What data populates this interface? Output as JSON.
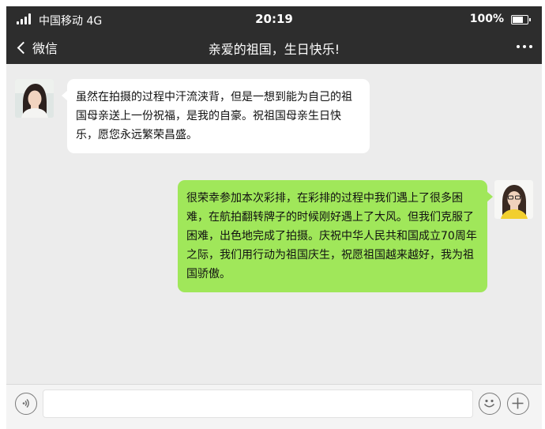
{
  "status_bar": {
    "carrier": "中国移动 4G",
    "time": "20:19",
    "battery": "100%",
    "battery_level": 1.0
  },
  "nav": {
    "back_label": "微信",
    "title": "亲爱的祖国，生日快乐!"
  },
  "messages": [
    {
      "side": "left",
      "text": "虽然在拍摄的过程中汗流浃背，但是一想到能为自己的祖国母亲送上一份祝福，是我的自豪。祝祖国母亲生日快乐，愿您永远繁荣昌盛。"
    },
    {
      "side": "right",
      "text": "很荣幸参加本次彩排，在彩排的过程中我们遇上了很多困难，在航拍翻转牌子的时候刚好遇上了大风。但我们克服了困难，出色地完成了拍摄。庆祝中华人民共和国成立70周年之际，我们用行动为祖国庆生，祝愿祖国越来越好，我为祖国骄傲。"
    }
  ],
  "input": {
    "value": ""
  },
  "icons": {
    "voice": "voice-icon",
    "emoji": "emoji-icon",
    "add": "plus-icon",
    "back": "chevron-left-icon",
    "more": "more-icon"
  }
}
